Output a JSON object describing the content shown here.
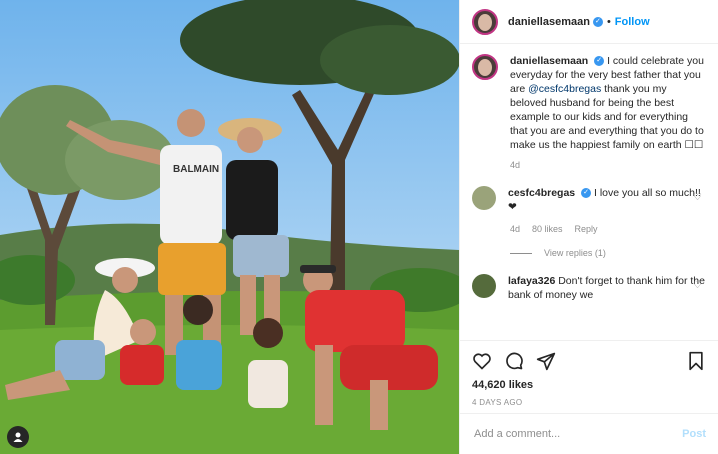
{
  "post": {
    "username": "daniellasemaan",
    "follow_label": "Follow",
    "separator": "•",
    "caption_text": "I could celebrate you everyday for the very best father that you are",
    "caption_mention": "@cesfc4bregas",
    "caption_rest": "thank you my beloved husband for being the best example to our kids and for everything that you are and everything that you do to make us the happiest family on earth ☐☐",
    "caption_age": "4d",
    "likes": "44,620 likes",
    "posted_ago": "4 DAYS AGO"
  },
  "comments": [
    {
      "username": "cesfc4bregas",
      "text": "I love you all so much!! ❤",
      "age": "4d",
      "likes": "80 likes",
      "reply": "Reply",
      "view_replies": "View replies (1)"
    },
    {
      "username": "lafaya326",
      "text": "Don't forget to thank him for the bank of money we"
    }
  ],
  "add_comment": {
    "placeholder": "Add a comment...",
    "post_label": "Post"
  },
  "icons": {
    "like": "heart-icon",
    "comment": "comment-icon",
    "share": "share-icon",
    "save": "bookmark-icon",
    "user_tag": "user-tag-icon",
    "verified": "verified-badge-icon"
  },
  "colors": {
    "accent": "#0095f6",
    "verified": "#3897f0",
    "muted": "#8e8e8e"
  }
}
